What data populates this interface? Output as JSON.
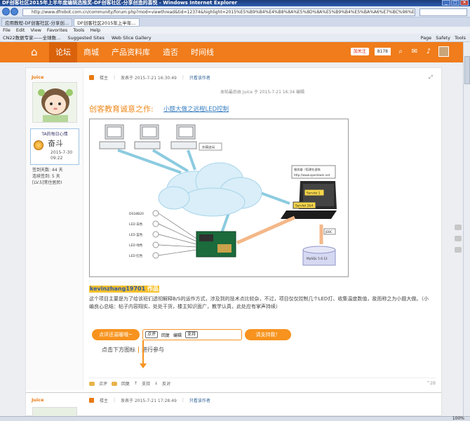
{
  "window": {
    "title": "DF创客社区2015年上半年度编辑选推奖-DF创客社区-分享创造的喜悦 - Windows Internet Explorer",
    "url": "http://www.dfrobot.com.cn/community/forum.php?mod=viewthread&tid=12374&highlight=2015%E5%B9%B4%E4%B8%8A%E5%8D%8A%E5%B9%B4%E5%BA%A6%E7%BC%96%E8%BE%91%E9%80%89%E6%8E%A8"
  },
  "tabs": [
    {
      "label": "应用教程-DF创客社区-分享创..."
    },
    {
      "label": "DF创客社区2015年上半年..."
    }
  ],
  "menubar": [
    "File",
    "Edit",
    "View",
    "Favorites",
    "Tools",
    "Help"
  ],
  "favorites": {
    "items": [
      "CN22数据专家——全球数...",
      "Suggested Sites",
      "Web Slice Gallery"
    ],
    "tools": [
      "Page",
      "Safety",
      "Tools"
    ]
  },
  "sitenav": {
    "items": [
      "论坛",
      "商城",
      "产品资料库",
      "造否",
      "时间线"
    ],
    "follow_label": "加关注",
    "follow_count": "8178"
  },
  "post": {
    "author": "Juice",
    "mood_title": "TA的每日心情",
    "mood_word": "奋斗",
    "mood_date": "2015-7-30",
    "mood_time": "09:22",
    "stats": [
      "签到天数: 44 天",
      "连续签到: 5 天",
      "[LV.5]常住居民I"
    ],
    "floor": "楼主",
    "posted": "发表于 2015-7-21 16:30:49",
    "only_author": "只看该作者",
    "edited_note": "本帖最后由 Juice 于 2015-7-21 16:34 编辑",
    "headline": "创客教育诚意之作:",
    "headline_link": "小题大做之远程LED控制",
    "author_tag": "kevinzhang19701",
    "author_tag_suffix": "作品",
    "paragraph": "这个项目主要是为了给该班们透彻解释B/S的运作方式，涉及到的技术点比较杂，不过，项目仅仅控制几个LED灯、收集温度数值，故而称之为小题大做。（小编良心总结：帖子内容翔实、处处干货，楼主知识面广，教学认真，此处应有掌声持续）",
    "guide_left": "点评还温暖哦~",
    "guide_buttons": [
      "点评",
      "回复",
      "编辑",
      "支持"
    ],
    "guide_right": "请支持我！",
    "guide_text_1": "点击下方图标",
    "guide_text_2": "进行参与",
    "footer_actions": [
      "点评",
      "回复",
      "支持",
      "反对"
    ],
    "footer_right": "^2B"
  },
  "diagram": {
    "cloud_label": "外网访问",
    "server_title": "服务器（搭建在虚拟",
    "server_url": "http://www.openlewin.net",
    "servlet1": "Servlet 1",
    "servlet2": "Servlet 2&4",
    "jdbc": "JDBC",
    "db": "MySQL 5.6.12",
    "sensors": [
      "DS18B20",
      "LED 白色",
      "LED 蓝色",
      "LED 绿色",
      "LED 红色"
    ]
  },
  "post2": {
    "author": "Juice",
    "floor": "楼主",
    "posted": "发表于 2015-7-21 17:28:49",
    "only_author": "只看该作者"
  },
  "status": {
    "zoom": "100%"
  }
}
